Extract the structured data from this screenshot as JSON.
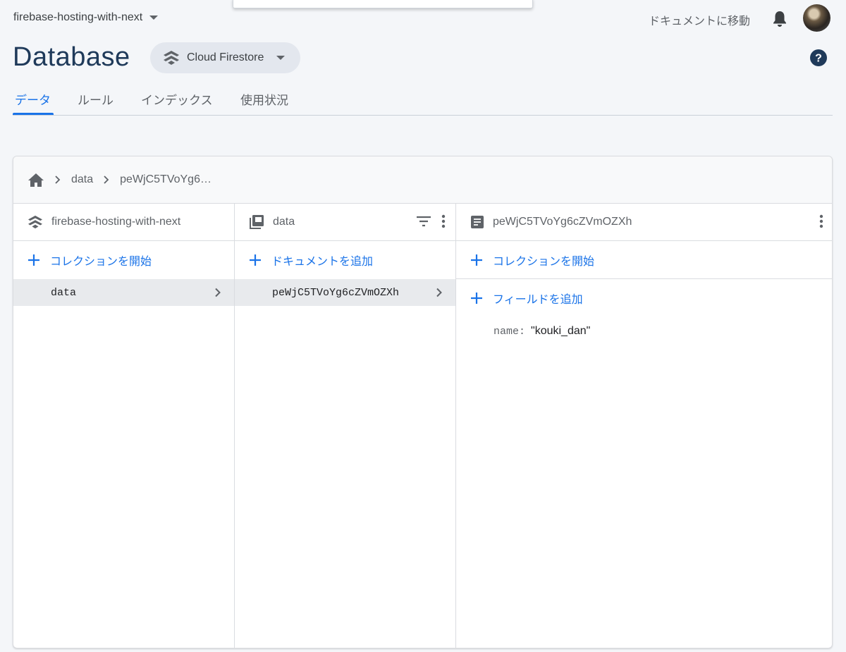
{
  "header": {
    "project_name": "firebase-hosting-with-next",
    "docs_link": "ドキュメントに移動",
    "page_title": "Database",
    "database_selector": "Cloud Firestore"
  },
  "tabs": [
    {
      "label": "データ",
      "active": true
    },
    {
      "label": "ルール",
      "active": false
    },
    {
      "label": "インデックス",
      "active": false
    },
    {
      "label": "使用状況",
      "active": false
    }
  ],
  "breadcrumb": {
    "items": [
      "data",
      "peWjC5TVoYg6…"
    ]
  },
  "columns": {
    "root": {
      "title": "firebase-hosting-with-next",
      "add_label": "コレクションを開始",
      "items": [
        "data"
      ]
    },
    "collection": {
      "title": "data",
      "add_label": "ドキュメントを追加",
      "items": [
        "peWjC5TVoYg6cZVmOZXh"
      ]
    },
    "document": {
      "title": "peWjC5TVoYg6cZVmOZXh",
      "add_collection_label": "コレクションを開始",
      "add_field_label": "フィールドを追加",
      "fields": [
        {
          "key": "name:",
          "value": "\"kouki_dan\""
        }
      ]
    }
  },
  "colors": {
    "accent": "#1a73e8",
    "title": "#1f3a5a",
    "background": "#f4f6f9"
  }
}
